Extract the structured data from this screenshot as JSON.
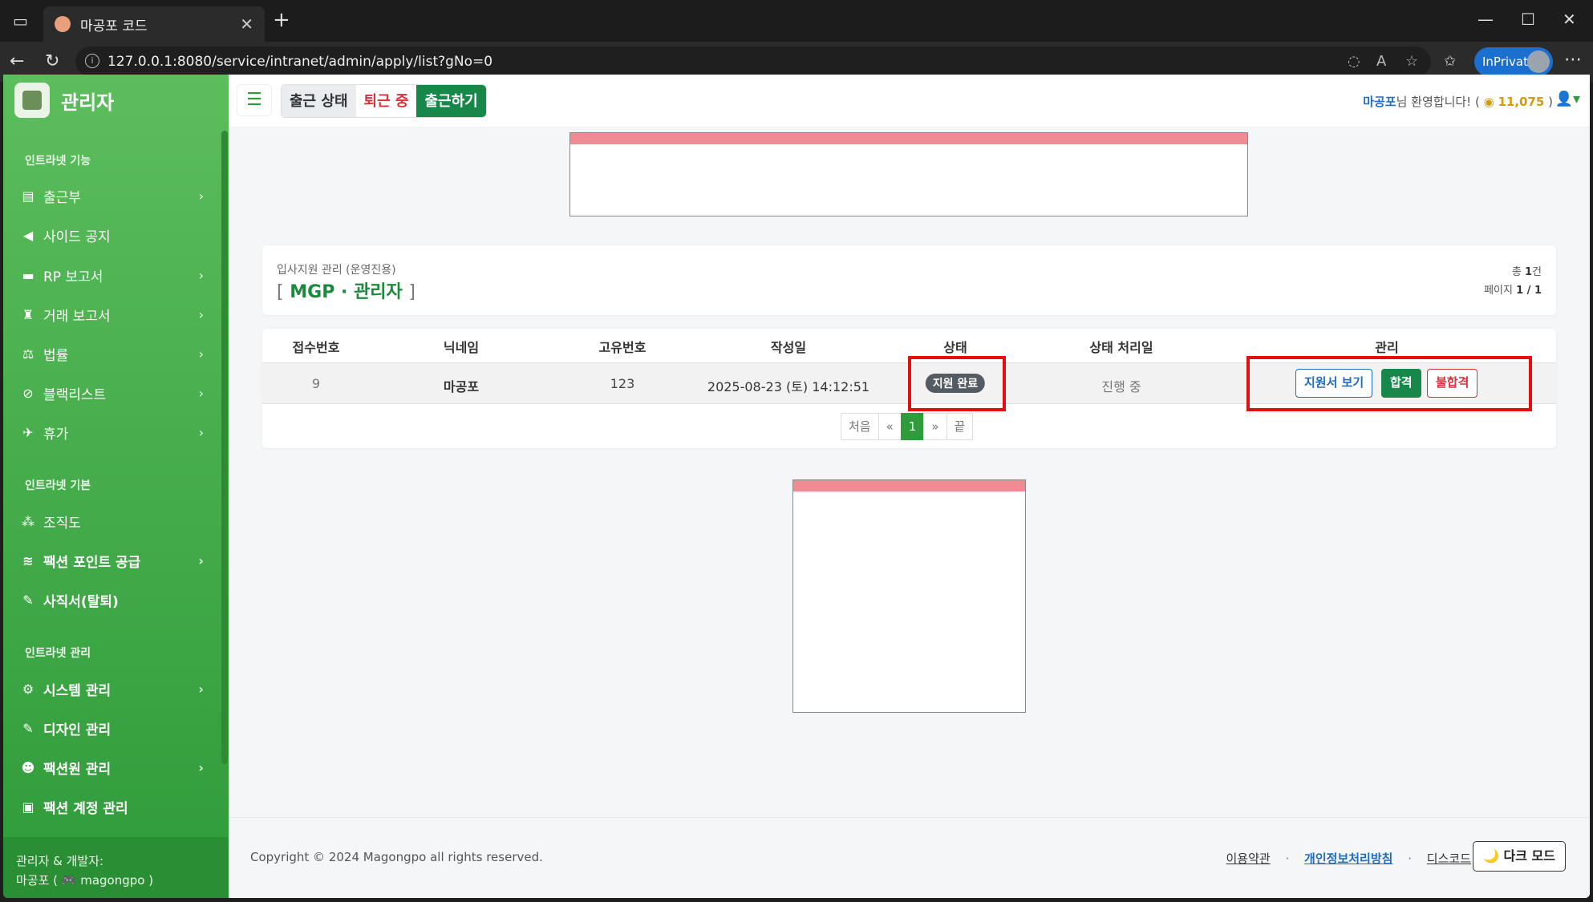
{
  "browser": {
    "tab_title": "마공포 코드",
    "url": "127.0.0.1:8080/service/intranet/admin/apply/list?gNo=0",
    "inprivate_label": "InPrivate"
  },
  "sidebar": {
    "brand": "관리자",
    "sections": [
      {
        "title": "인트라넷 기능"
      },
      {
        "title": "인트라넷 기본"
      },
      {
        "title": "인트라넷 관리"
      }
    ],
    "items": [
      {
        "label": "출근부",
        "icon": "book-icon",
        "has_children": true
      },
      {
        "label": "사이드 공지",
        "icon": "megaphone-icon",
        "has_children": false
      },
      {
        "label": "RP 보고서",
        "icon": "gamepad-icon",
        "has_children": true
      },
      {
        "label": "거래 보고서",
        "icon": "money-bag-icon",
        "has_children": true
      },
      {
        "label": "법률",
        "icon": "scale-icon",
        "has_children": true
      },
      {
        "label": "블랙리스트",
        "icon": "ban-icon",
        "has_children": true
      },
      {
        "label": "휴가",
        "icon": "plane-icon",
        "has_children": true
      },
      {
        "label": "조직도",
        "icon": "sitemap-icon",
        "has_children": false
      },
      {
        "label": "팩션 포인트 공급",
        "icon": "coins-icon",
        "has_children": true
      },
      {
        "label": "사직서(탈퇴)",
        "icon": "pen-icon",
        "has_children": false
      },
      {
        "label": "시스템 관리",
        "icon": "gear-icon",
        "has_children": true
      },
      {
        "label": "디자인 관리",
        "icon": "brush-icon",
        "has_children": false
      },
      {
        "label": "팩션원 관리",
        "icon": "user-gear-icon",
        "has_children": true
      },
      {
        "label": "팩션 계정 관리",
        "icon": "id-card-icon",
        "has_children": false
      }
    ],
    "footer_line1": "관리자 & 개발자:",
    "footer_line2": "마공포 ( 🎮 magongpo )"
  },
  "topbar": {
    "status_label": "출근 상태",
    "status_value": "퇴근 중",
    "clockin_button": "출근하기",
    "welcome_name": "마공포",
    "welcome_text": "님 환영합니다! (",
    "coins": "11,075",
    "welcome_close": ")"
  },
  "panel": {
    "subtitle": "입사지원 관리 (운영진용)",
    "title_open": "[",
    "title": "MGP · 관리자",
    "title_close": "]",
    "total_label": "총",
    "total_value": "1",
    "total_unit": "건",
    "page_label": "페이지",
    "page_value": "1 / 1"
  },
  "table": {
    "headers": [
      "접수번호",
      "닉네임",
      "고유번호",
      "작성일",
      "상태",
      "상태 처리일",
      "관리"
    ],
    "rows": [
      {
        "id": "9",
        "nickname": "마공포",
        "unique_no": "123",
        "date": "2025-08-23 (토) 14:12:51",
        "status": "지원 완료",
        "processed": "진행 중",
        "actions": {
          "view": "지원서 보기",
          "pass": "합격",
          "fail": "불합격"
        }
      }
    ]
  },
  "pagination": {
    "first": "처음",
    "prev": "«",
    "current": "1",
    "next": "»",
    "last": "끝"
  },
  "footer": {
    "copyright": "Copyright © 2024 Magongpo all rights reserved.",
    "terms": "이용약관",
    "privacy": "개인정보처리방침",
    "discord": "디스코드",
    "separator": "·",
    "dark_mode": "🌙 다크 모드"
  },
  "colors": {
    "sidebar_green": "#3fa845",
    "accent_green": "#17874a",
    "danger_red": "#d9303b",
    "link_blue": "#1f6cc4",
    "highlight_red": "#e01010"
  }
}
